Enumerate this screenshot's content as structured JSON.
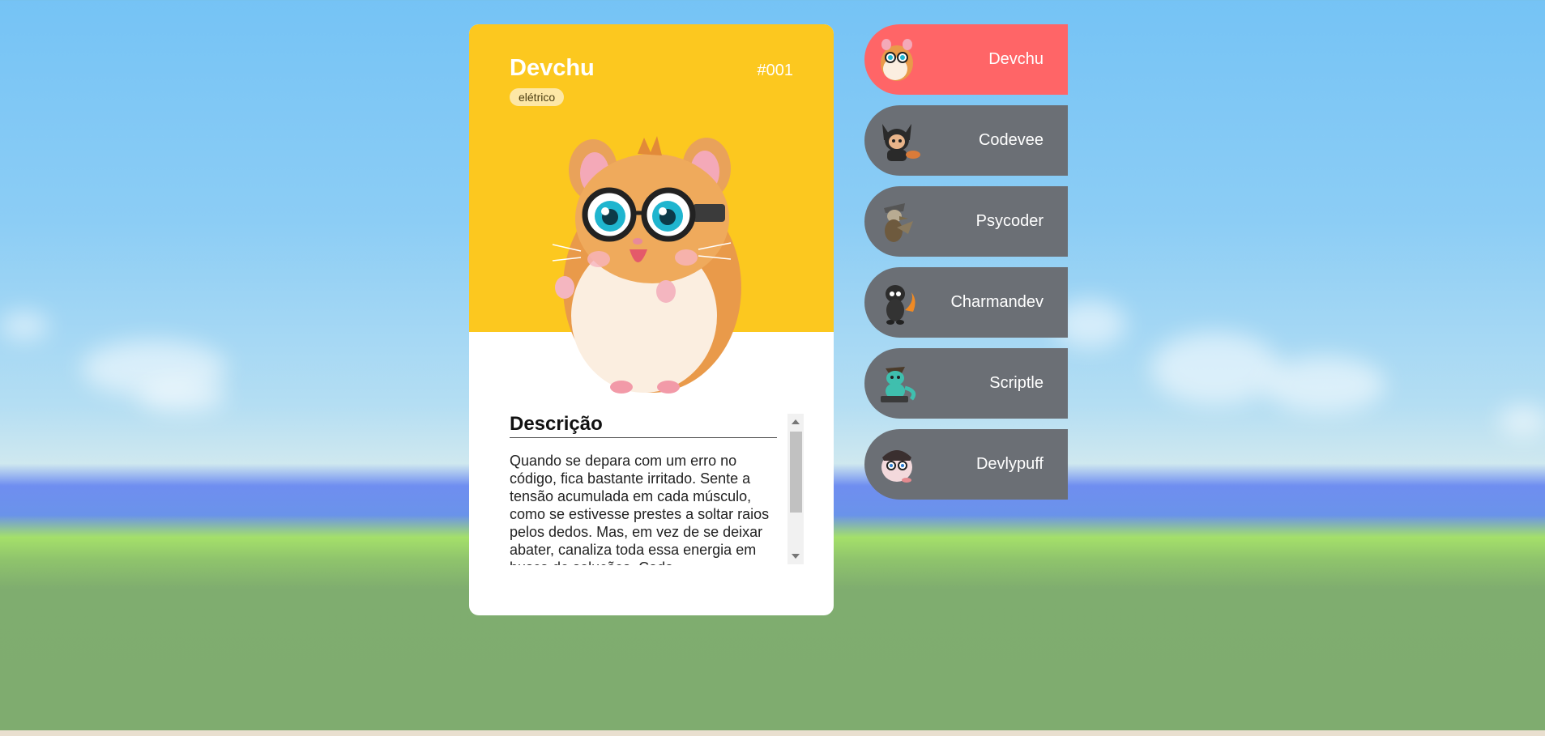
{
  "selected": {
    "name": "Devchu",
    "number": "#001",
    "type": "elétrico",
    "description_title": "Descrição",
    "description": "Quando se depara com um erro no código, fica bastante irritado. Sente a tensão acumulada em cada músculo, como se estivesse prestes a soltar raios pelos dedos. Mas, em vez de se deixar abater, canaliza toda essa energia em busca de soluções. Cada",
    "theme_color": "#fcc81f"
  },
  "list": [
    {
      "label": "Devchu",
      "icon": "hamster-glasses-icon",
      "active": true
    },
    {
      "label": "Codevee",
      "icon": "fox-hoodie-icon",
      "active": false
    },
    {
      "label": "Psycoder",
      "icon": "duck-hat-icon",
      "active": false
    },
    {
      "label": "Charmandev",
      "icon": "lizard-flame-icon",
      "active": false
    },
    {
      "label": "Scriptle",
      "icon": "turtle-laptop-icon",
      "active": false
    },
    {
      "label": "Devlypuff",
      "icon": "puffball-glasses-icon",
      "active": false
    }
  ],
  "colors": {
    "active_item": "#ff6567",
    "inactive_item": "#6b6f75",
    "card_header": "#fcc81f"
  }
}
